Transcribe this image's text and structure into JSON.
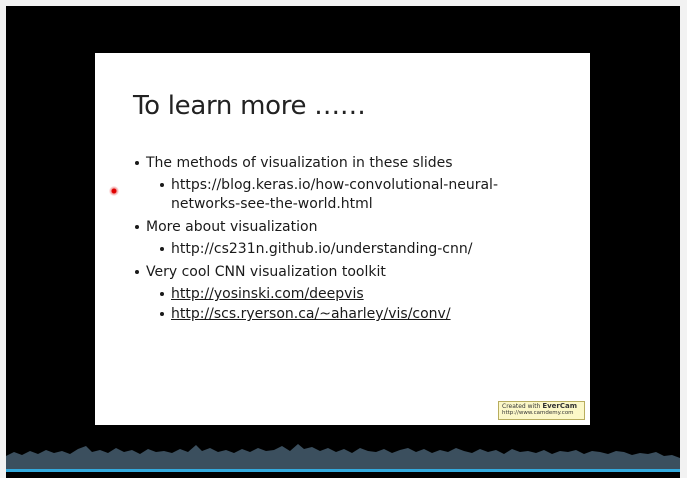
{
  "slide": {
    "title": "To learn more ……",
    "bullets": [
      {
        "text": "The methods of visualization in these slides",
        "sub": [
          {
            "lines": [
              "https://blog.keras.io/how-convolutional-neural-",
              "networks-see-the-world.html"
            ],
            "underlined": false
          }
        ]
      },
      {
        "text": "More about visualization",
        "sub": [
          {
            "lines": [
              "http://cs231n.github.io/understanding-cnn/"
            ],
            "underlined": false
          }
        ]
      },
      {
        "text": "Very cool CNN visualization toolkit",
        "sub": [
          {
            "lines": [
              "http://yosinski.com/deepvis"
            ],
            "underlined": true
          },
          {
            "lines": [
              "http://scs.ryerson.ca/~aharley/vis/conv/"
            ],
            "underlined": true
          }
        ]
      }
    ]
  },
  "watermark": {
    "prefix": "Created with",
    "brand": "EverCam",
    "url": "http://www.camdemy.com"
  },
  "player": {
    "progress": 0.0
  },
  "colors": {
    "background": "#000000",
    "slide": "#ffffff",
    "cursor": "#e00000",
    "timeline": "#3b4f5e",
    "progress": "#33aadd"
  }
}
